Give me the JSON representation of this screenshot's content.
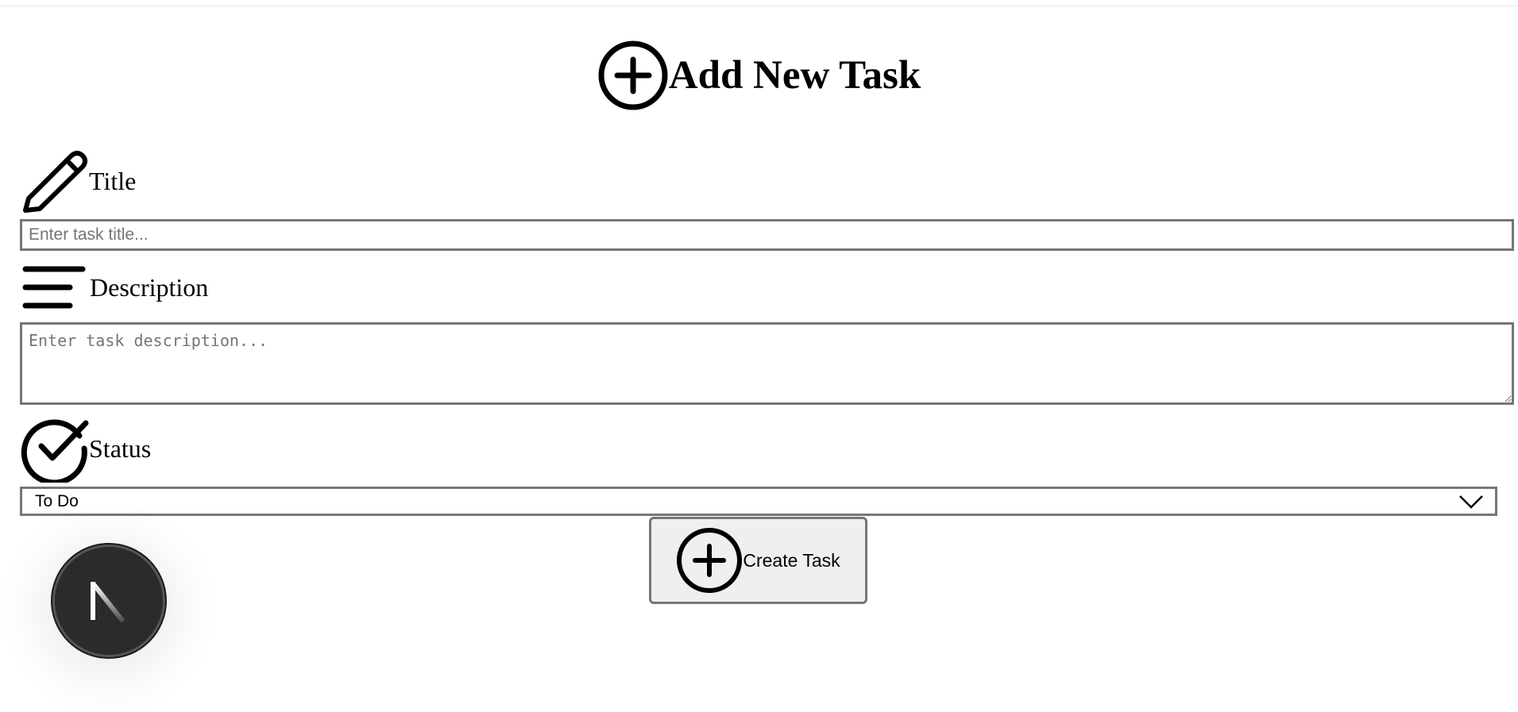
{
  "page": {
    "heading": "Add New Task",
    "heading_icon": "plus-circle-icon"
  },
  "form": {
    "title_label": "Title",
    "title_icon": "pencil-icon",
    "title_placeholder": "Enter task title...",
    "title_value": "",
    "description_label": "Description",
    "description_icon": "text-lines-icon",
    "description_placeholder": "Enter task description...",
    "description_value": "",
    "status_label": "Status",
    "status_icon": "check-circle-icon",
    "status_value": "To Do",
    "submit_label": "Create Task",
    "submit_icon": "plus-circle-icon"
  },
  "dev_indicator": {
    "letter": "N",
    "icon": "nextjs-logo-icon"
  }
}
